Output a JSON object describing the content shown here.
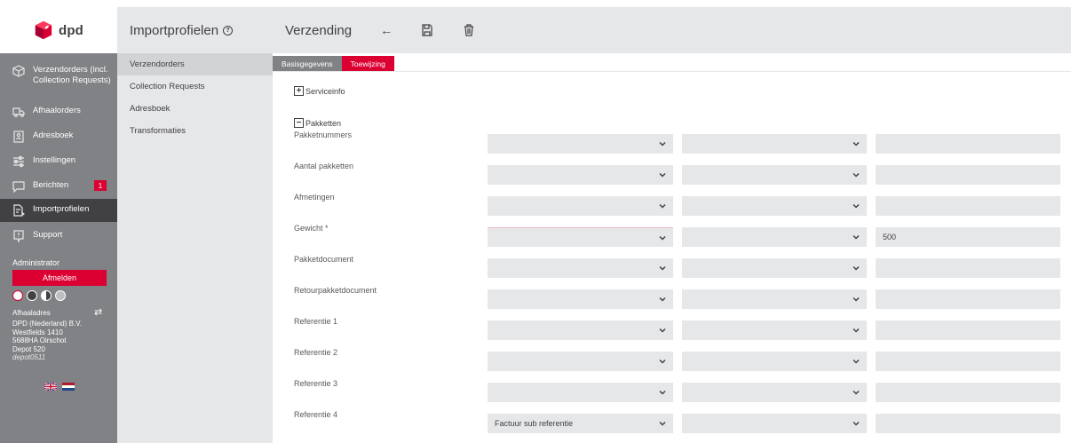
{
  "brand": {
    "logo_text": "dpd",
    "accent": "#dc0032"
  },
  "sidebar": {
    "items": [
      {
        "label": "Verzendorders (incl. Collection Requests)",
        "icon": "box-icon"
      },
      {
        "label": "Afhaalorders",
        "icon": "truck-icon"
      },
      {
        "label": "Adresboek",
        "icon": "address-book-icon"
      },
      {
        "label": "Instellingen",
        "icon": "sliders-icon"
      },
      {
        "label": "Berichten",
        "icon": "message-icon",
        "badge": "1"
      },
      {
        "label": "Importprofielen",
        "icon": "import-file-icon"
      },
      {
        "label": "Support",
        "icon": "support-icon"
      }
    ],
    "admin_label": "Administrator",
    "logout_label": "Afmelden",
    "pickup_label": "Afhaaladres",
    "address": {
      "name": "DPD (Nederland) B.V.",
      "street": "Westfields 1410",
      "city": "5688HA Oirschot",
      "depot": "Depot 520",
      "depot_code": "depot0511"
    }
  },
  "subnav": {
    "title": "Importprofielen",
    "items": [
      "Verzendorders",
      "Collection Requests",
      "Adresboek",
      "Transformaties"
    ]
  },
  "topbar": {
    "title": "Verzending",
    "back_symbol": "←"
  },
  "tabs": [
    "Basisgegevens",
    "Toewijzing"
  ],
  "sections": {
    "service": "Serviceinfo",
    "packages": "Pakketten"
  },
  "rows": [
    {
      "label": "Pakketnummers",
      "sel_a": "",
      "sel_b": "",
      "input": ""
    },
    {
      "label": "Aantal pakketten",
      "sel_a": "",
      "sel_b": "",
      "input": ""
    },
    {
      "label": "Afmetingen",
      "sel_a": "",
      "sel_b": "",
      "input": ""
    },
    {
      "label": "Gewicht *",
      "sel_a": "",
      "sel_b": "",
      "input": "500"
    },
    {
      "label": "Pakketdocument",
      "sel_a": "",
      "sel_b": "",
      "input": ""
    },
    {
      "label": "Retourpakketdocument",
      "sel_a": "",
      "sel_b": "",
      "input": ""
    },
    {
      "label": "Referentie 1",
      "sel_a": "",
      "sel_b": "",
      "input": ""
    },
    {
      "label": "Referentie 2",
      "sel_a": "",
      "sel_b": "",
      "input": ""
    },
    {
      "label": "Referentie 3",
      "sel_a": "",
      "sel_b": "",
      "input": ""
    },
    {
      "label": "Referentie 4",
      "sel_a": "Factuur sub referentie",
      "sel_b": "",
      "input": ""
    }
  ]
}
